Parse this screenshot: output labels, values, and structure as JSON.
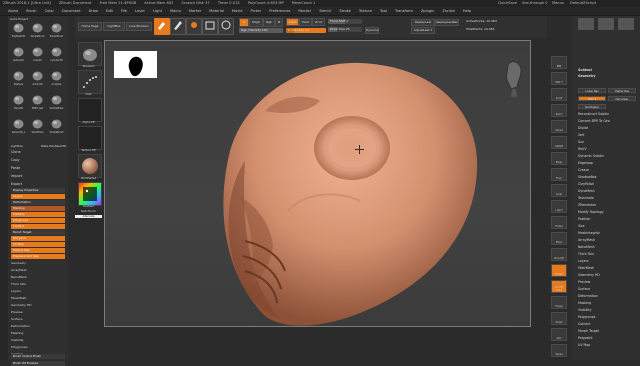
{
  "title_bar": {
    "app_title": "ZBrush 2018.1 [Ultra Unit]",
    "document": "ZBrush Document",
    "free_mem": "Free Mem 21.499GB",
    "active_mem": "Active Mem 802",
    "scratch_disk": "Scratch Disk 37",
    "timer": "Timer 0.013",
    "poly_count": "PolyCount 4.653 MP",
    "mesh_count": "MeshCount 1",
    "right_items": [
      "QuickSave",
      "See-through 0",
      "Menus",
      "DefaultZScript"
    ]
  },
  "menu_bar": [
    "Alpha",
    "Brush",
    "Color",
    "Document",
    "Draw",
    "Edit",
    "File",
    "Layer",
    "Light",
    "Macro",
    "Marker",
    "Material",
    "Movie",
    "Picker",
    "Preferences",
    "Render",
    "Stencil",
    "Stroke",
    "Texture",
    "Tool",
    "Transform",
    "Zplugin",
    "Zscript",
    "Help"
  ],
  "toolbar": {
    "home_page": "Home Page",
    "lightbox": "LightBox",
    "live_boolean": "Live Boolean",
    "modes": [
      "Edit",
      "Draw",
      "Move",
      "Scale",
      "Rotate"
    ],
    "a_btn": "A",
    "mrgb": "Mrgb",
    "rgb": "Rgb",
    "m": "M",
    "zadd": "Zadd",
    "zsub": "Zsub",
    "zcut": "Zcut",
    "rgb_intensity": "Rgb Intensity 100",
    "z_intensity": "Z Intensity 19",
    "focal_shift": "Focal Shift 0",
    "draw_size": "Draw Size 25",
    "dynamic": "Dynamic",
    "replay_last": "ReplayLast",
    "replay_last_rel": "ReplayLastRel",
    "active_points": "ActivePoints: 10.484",
    "total_points": "TotalPoints: 10.484",
    "adjust_last": "AdjustLast 1"
  },
  "toolbar_levels": {
    "rgb_intensity": 1.0,
    "z_intensity": 0.19,
    "focal_shift": 0.5,
    "draw_size": 0.25
  },
  "left_panel": {
    "header": "Gold Project",
    "tool_labels": [
      "PolyMesh3D",
      "SimpleBrush",
      "EraserBrush",
      "Sphere3D",
      "Cube3D",
      "Cylinder3D",
      "ZSphere",
      "Gizmo3D",
      "ArcAlpha",
      "Plane3D",
      "PM3D_Sph",
      "SkinOsPhere",
      "Sphere3D_1",
      "SkinsPhere",
      "SimpleBrush"
    ],
    "buttons": [
      "Lightbox",
      "Tools",
      "Make PolyMesh3D",
      "GoZ",
      "All",
      "Visible",
      "R"
    ],
    "section_items": [
      "Clone",
      "Copy",
      "Paste",
      "Import",
      "Export"
    ],
    "subtools_header": "Subtool",
    "layers": [
      "Display Properties",
      "Layers",
      "Deformation",
      "Masking",
      "Visibility",
      "Polygroups",
      "Contact",
      "Morph Target",
      "Polypaint",
      "UV Map",
      "Texture Map",
      "Displacement Map",
      "Normal Map",
      "Vector Displacement Map",
      "Unified Skin",
      "Initialize",
      "Import",
      "Export"
    ],
    "lower_items": [
      "Geometry",
      "ArrayMesh",
      "NanoMesh",
      "Thick Skin",
      "Layers",
      "FiberMesh",
      "Geometry HD",
      "Preview",
      "Surface",
      "Deformation",
      "Masking",
      "Visibility",
      "Polygroups",
      "Contact",
      "Morph Target",
      "Polypaint",
      "UV Map"
    ],
    "bottom_items": [
      "Brush Control Brush",
      "Brush Hit Brushes"
    ]
  },
  "brush_column": {
    "labels": [
      "Standard",
      "Dots",
      "Alpha Off",
      "Texture Off",
      "SkinShade4",
      "Gradient",
      "SwitchColor",
      "Alternate"
    ]
  },
  "right_shelf": {
    "buttons": [
      "BPR",
      "SPix 3",
      "Scroll",
      "Zoom",
      "Actual",
      "AAHalf",
      "Persp",
      "Floor",
      "Local",
      "L.Sym",
      "Frame",
      "Move",
      "Zoom3D",
      "Rotate",
      "Line Fill PolyF",
      "Transp",
      "Ghost",
      "Solo",
      "Xpose"
    ]
  },
  "right_tray": {
    "top_thumbs": [
      "PolyMesh3D",
      "SimpleBrush",
      "PolyMesh3D"
    ],
    "items": [
      "Subtool",
      "Geometry",
      "Lower Res",
      "Higher Res",
      "SDiv 4",
      "Del Lower",
      "Del Higher",
      "Reconstruct Subdiv",
      "Convert BPR To Geo",
      "Divide",
      "Smt",
      "Suv",
      "ReUV",
      "Dynamic Subdiv",
      "Edgeloop",
      "Crease",
      "ShadowBox",
      "ClayPolish",
      "DynaMesh",
      "Tessimate",
      "ZRemesher",
      "Modify Topology",
      "Position",
      "Size",
      "MeshIntegrity",
      "ArrayMesh",
      "NanoMesh",
      "Thick Skin",
      "Layers",
      "FiberMesh",
      "Geometry HD",
      "Preview",
      "Surface",
      "Deformation",
      "Masking",
      "Visibility",
      "Polygroups",
      "Contact",
      "Morph Target",
      "Polypaint",
      "UV Map"
    ]
  },
  "colors": {
    "accent": "#e67a1c",
    "skin": "#d89a7c",
    "viewport_bg": "#3f3f3f",
    "panel_bg": "#2f2f2f"
  },
  "icons": [
    "brush-thumbnail-icon",
    "color-picker-icon",
    "head-navigator-icon",
    "cursor-cross-icon",
    "alpha-shape-icon"
  ]
}
